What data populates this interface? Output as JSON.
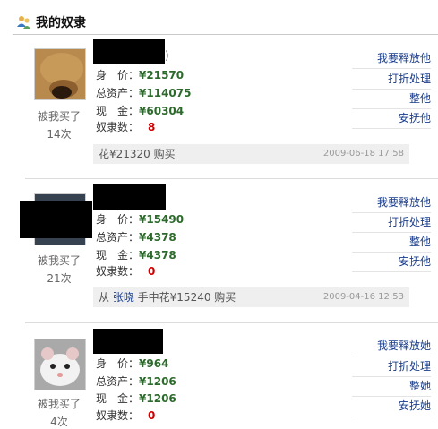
{
  "header": {
    "title": "我的奴隶",
    "icon": "people-icon"
  },
  "labels": {
    "price": "身　价：",
    "assets": "总资产：",
    "cash": "现　金：",
    "slaves": "奴隶数：",
    "bought_prefix": "被我买了"
  },
  "actions": [
    "我要释放他",
    "打折处理",
    "整他",
    "安抚他"
  ],
  "actions_3": [
    "我要释放她",
    "打折处理",
    "整她",
    "安抚她"
  ],
  "slaves": [
    {
      "name_paren": ")",
      "price": "¥21570",
      "assets": "¥114075",
      "cash": "¥60304",
      "slave_count": "8",
      "bought_times": "14次",
      "note_text": "花¥21320 购买",
      "note_date": "2009-06-18 17:58"
    },
    {
      "price": "¥15490",
      "assets": "¥4378",
      "cash": "¥4378",
      "slave_count": "0",
      "bought_times": "21次",
      "note_prefix": "从 ",
      "note_link": "张晓",
      "note_text": " 手中花¥15240 购买",
      "note_date": "2009-04-16 12:53"
    },
    {
      "price": "¥964",
      "assets": "¥1206",
      "cash": "¥1206",
      "slave_count": "0",
      "bought_times": "4次"
    }
  ]
}
